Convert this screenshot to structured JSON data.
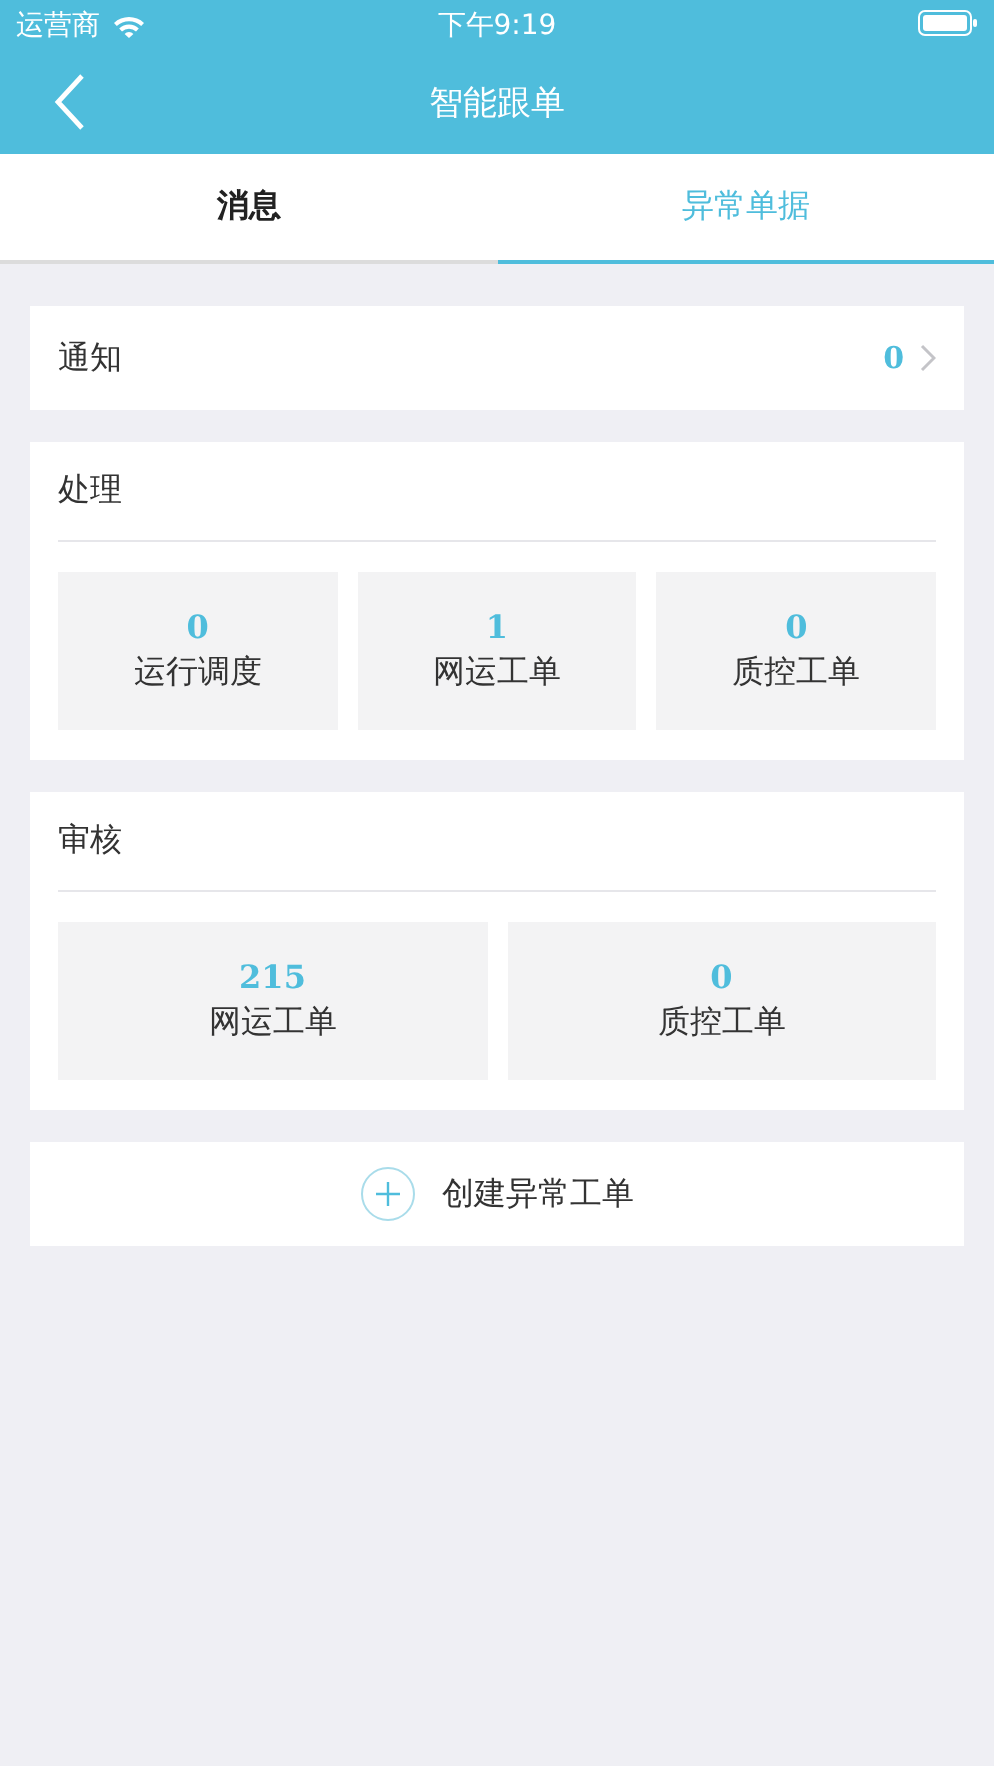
{
  "status_bar": {
    "carrier": "运营商",
    "time": "下午9:19"
  },
  "nav_bar": {
    "title": "智能跟单"
  },
  "tabs": [
    {
      "label": "消息",
      "selected": false
    },
    {
      "label": "异常单据",
      "selected": true
    }
  ],
  "notice": {
    "label": "通知",
    "count": "0"
  },
  "sections": [
    {
      "title": "处理",
      "tiles": [
        {
          "count": "0",
          "label": "运行调度"
        },
        {
          "count": "1",
          "label": "网运工单"
        },
        {
          "count": "0",
          "label": "质控工单"
        }
      ]
    },
    {
      "title": "审核",
      "tiles": [
        {
          "count": "215",
          "label": "网运工单"
        },
        {
          "count": "0",
          "label": "质控工单"
        }
      ]
    }
  ],
  "create_button": {
    "label": "创建异常工单"
  }
}
